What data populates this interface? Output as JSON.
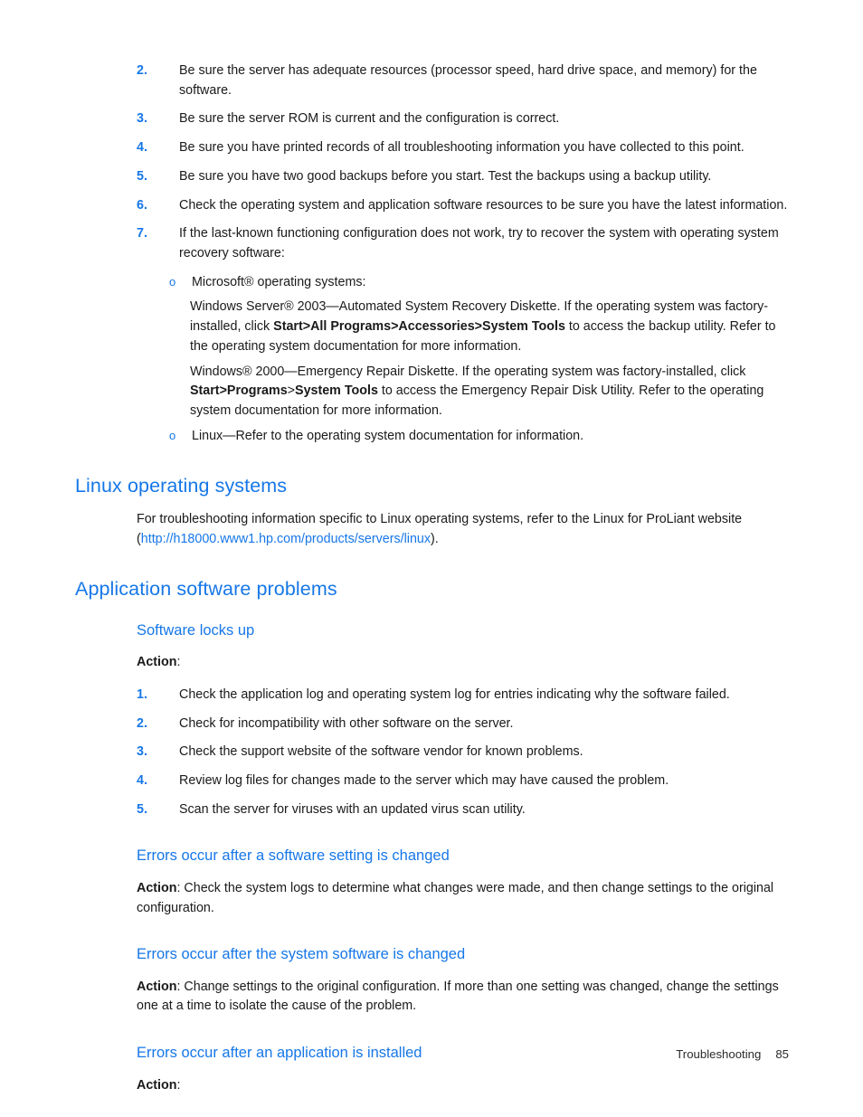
{
  "document": {
    "top_list_start": 2,
    "items": [
      {
        "num": "2.",
        "text": "Be sure the server has adequate resources (processor speed, hard drive space, and memory) for the software."
      },
      {
        "num": "3.",
        "text": "Be sure the server ROM is current and the configuration is correct."
      },
      {
        "num": "4.",
        "text": "Be sure you have printed records of all troubleshooting information you have collected to this point."
      },
      {
        "num": "5.",
        "text": "Be sure you have two good backups before you start. Test the backups using a backup utility."
      },
      {
        "num": "6.",
        "text": "Check the operating system and application software resources to be sure you have the latest information."
      },
      {
        "num": "7.",
        "text": "If the last-known functioning configuration does not work, try to recover the system with operating system recovery software:"
      }
    ],
    "sub_bullets": {
      "bullet_glyph": "o",
      "microsoft_label": "Microsoft® operating systems:",
      "win2003": {
        "before_bold": "Windows Server® 2003—Automated System Recovery Diskette. If the operating system was factory-installed, click ",
        "bold": "Start>All Programs>Accessories>System Tools",
        "after_bold": " to access the backup utility. Refer to the operating system documentation for more information."
      },
      "win2000": {
        "before_bold": "Windows® 2000—Emergency Repair Diskette. If the operating system was factory-installed, click ",
        "bold1": "Start>Programs",
        "separator": ">",
        "bold2": "System Tools",
        "after_bold": " to access the Emergency Repair Disk Utility. Refer to the operating system documentation for more information."
      },
      "linux_label": "Linux—Refer to the operating system documentation for information."
    },
    "linux_section": {
      "heading": "Linux operating systems",
      "paragraph_before_link": "For troubleshooting information specific to Linux operating systems, refer to the Linux for ProLiant website (",
      "link": "http://h18000.www1.hp.com/products/servers/linux",
      "paragraph_after_link": ")."
    },
    "app_software_section": {
      "heading": "Application software problems",
      "subsections": [
        {
          "heading": "Software locks up",
          "action_label": "Action",
          "action_colon": ":",
          "steps": [
            {
              "num": "1.",
              "text": "Check the application log and operating system log for entries indicating why the software failed."
            },
            {
              "num": "2.",
              "text": "Check for incompatibility with other software on the server."
            },
            {
              "num": "3.",
              "text": "Check the support website of the software vendor for known problems."
            },
            {
              "num": "4.",
              "text": "Review log files for changes made to the server which may have caused the problem."
            },
            {
              "num": "5.",
              "text": "Scan the server for viruses with an updated virus scan utility."
            }
          ]
        },
        {
          "heading": "Errors occur after a software setting is changed",
          "action_label": "Action",
          "action_text": ": Check the system logs to determine what changes were made, and then change settings to the original configuration."
        },
        {
          "heading": "Errors occur after the system software is changed",
          "action_label": "Action",
          "action_text": ": Change settings to the original configuration. If more than one setting was changed, change the settings one at a time to isolate the cause of the problem."
        },
        {
          "heading": "Errors occur after an application is installed",
          "action_label": "Action",
          "action_text": ":"
        }
      ]
    },
    "footer": {
      "chapter": "Troubleshooting",
      "page_number": "85"
    },
    "colors": {
      "heading_blue": "#1677e8",
      "link_blue": "#1677e8",
      "body_black": "#1a1a1a"
    }
  }
}
